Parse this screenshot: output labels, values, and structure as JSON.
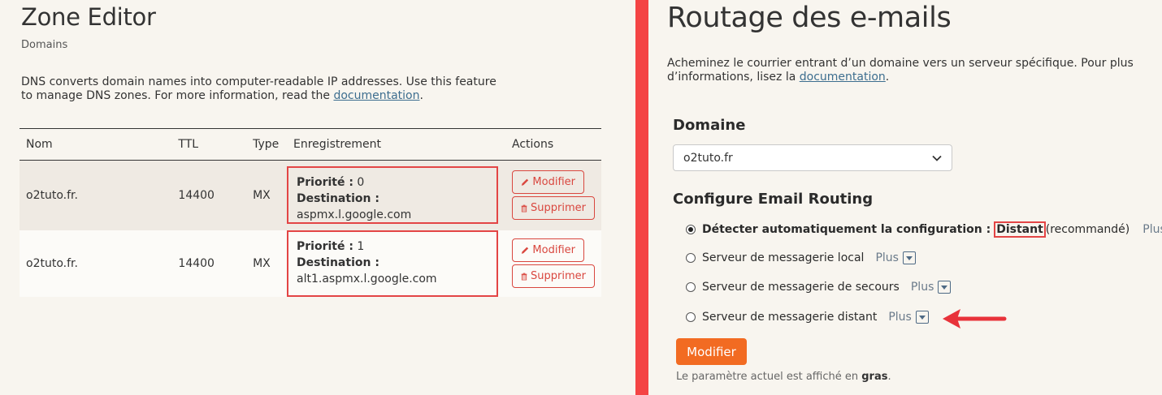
{
  "zone": {
    "title": "Zone Editor",
    "subtitle": "Domains",
    "desc_text": "DNS converts domain names into computer-readable IP addresses. Use this feature to manage DNS zones. For more information, read the ",
    "doc_link": "documentation",
    "desc_end": ".",
    "table": {
      "headers": [
        "Nom",
        "TTL",
        "Type",
        "Enregistrement",
        "Actions"
      ],
      "rows": [
        {
          "name": "o2tuto.fr.",
          "ttl": "14400",
          "type": "MX",
          "priority_label": "Priorité :",
          "priority": "0",
          "dest_label": "Destination :",
          "dest": "aspmx.l.google.com"
        },
        {
          "name": "o2tuto.fr.",
          "ttl": "14400",
          "type": "MX",
          "priority_label": "Priorité :",
          "priority": "1",
          "dest_label": "Destination :",
          "dest": "alt1.aspmx.l.google.com"
        }
      ],
      "modify_label": "Modifier",
      "delete_label": "Supprimer"
    }
  },
  "routing": {
    "title": "Routage des e-mails",
    "desc_text": "Acheminez le courrier entrant d’un domaine vers un serveur spécifique. Pour plus d’informations, lisez la ",
    "doc_link": "documentation",
    "desc_end": ".",
    "domain_label": "Domaine",
    "domain_value": "o2tuto.fr",
    "config_label": "Configure Email Routing",
    "options": [
      {
        "label": "Détecter automatiquement la configuration :",
        "value": "Distant",
        "suffix": "(recommandé)",
        "selected": true
      },
      {
        "label": "Serveur de messagerie local",
        "selected": false
      },
      {
        "label": "Serveur de messagerie de secours",
        "selected": false
      },
      {
        "label": "Serveur de messagerie distant",
        "selected": false
      }
    ],
    "more_label": "Plus",
    "submit_label": "Modifier",
    "footnote_text": "Le paramètre actuel est affiché en ",
    "footnote_bold": "gras",
    "footnote_end": "."
  },
  "colors": {
    "accent": "#f26b22",
    "danger": "#d9473f",
    "highlight": "#e34545",
    "divider": "#f44444"
  }
}
